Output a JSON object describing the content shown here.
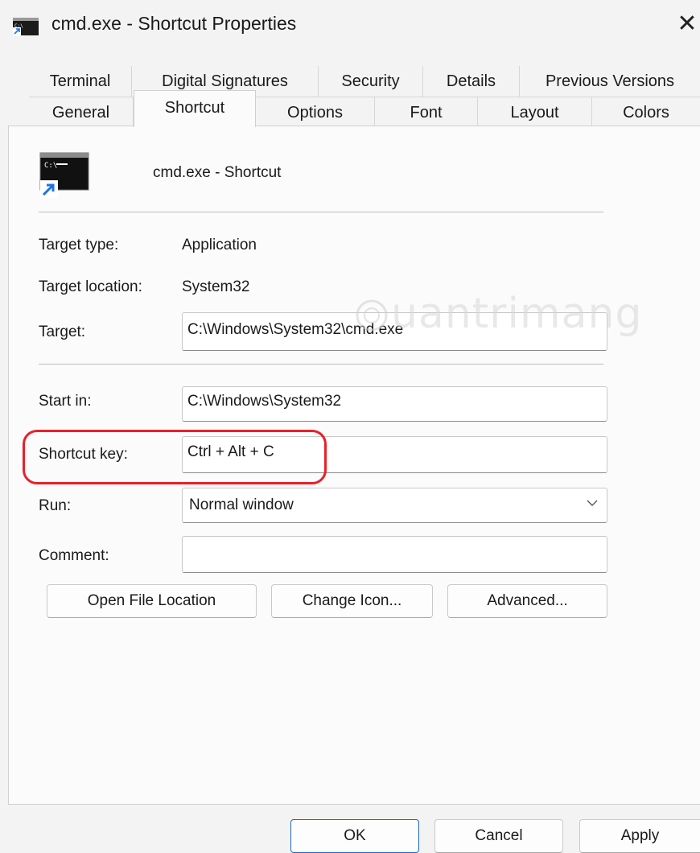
{
  "window": {
    "title": "cmd.exe - Shortcut Properties",
    "close_icon": "close-icon",
    "app_icon": "cmd-icon"
  },
  "tabs": {
    "row1": [
      "Terminal",
      "Digital Signatures",
      "Security",
      "Details",
      "Previous Versions"
    ],
    "row2": [
      "General",
      "Shortcut",
      "Options",
      "Font",
      "Layout",
      "Colors"
    ],
    "active": "Shortcut"
  },
  "shortcut": {
    "name": "cmd.exe - Shortcut",
    "target_type_label": "Target type:",
    "target_type_value": "Application",
    "target_location_label": "Target location:",
    "target_location_value": "System32",
    "target_label": "Target:",
    "target_value": "C:\\Windows\\System32\\cmd.exe",
    "start_in_label": "Start in:",
    "start_in_value": "C:\\Windows\\System32",
    "shortcut_key_label": "Shortcut key:",
    "shortcut_key_value": "Ctrl + Alt + C",
    "run_label": "Run:",
    "run_value": "Normal window",
    "comment_label": "Comment:",
    "comment_value": ""
  },
  "buttons": {
    "open_file_location": "Open File Location",
    "change_icon": "Change Icon...",
    "advanced": "Advanced..."
  },
  "footer": {
    "ok": "OK",
    "cancel": "Cancel",
    "apply": "Apply"
  },
  "watermark": "uantrimang",
  "colors": {
    "highlight": "#e8202a",
    "primary_border": "#1f66c4"
  }
}
